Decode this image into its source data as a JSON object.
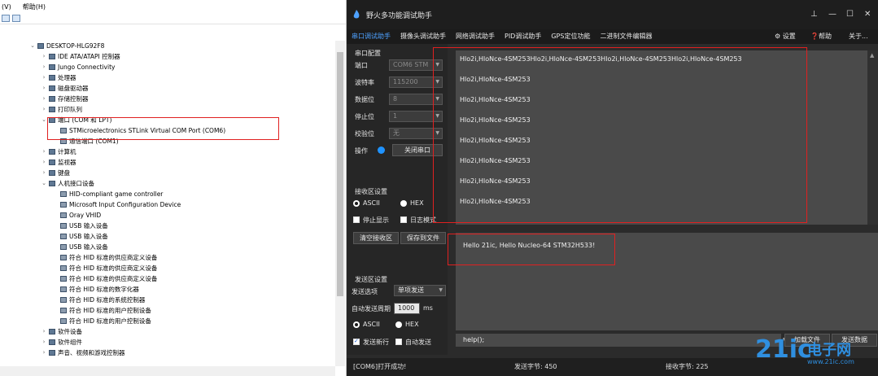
{
  "device_manager": {
    "menu": [
      "(V)",
      "帮助(H)"
    ],
    "tree": [
      {
        "label": "DESKTOP-HLG92F8",
        "arrow": "⌄"
      },
      {
        "label": "IDE ATA/ATAPI 控制器",
        "arrow": "›"
      },
      {
        "label": "Jungo Connectivity",
        "arrow": "›"
      },
      {
        "label": "处理器",
        "arrow": "›"
      },
      {
        "label": "磁盘驱动器",
        "arrow": "›"
      },
      {
        "label": "存储控制器",
        "arrow": "›"
      },
      {
        "label": "打印队列",
        "arrow": "›"
      },
      {
        "label": "端口 (COM 和 LPT)",
        "arrow": "⌄"
      },
      {
        "label": "STMicroelectronics STLink Virtual COM Port (COM6)",
        "arrow": ""
      },
      {
        "label": "通信端口 (COM1)",
        "arrow": ""
      },
      {
        "label": "计算机",
        "arrow": "›"
      },
      {
        "label": "监视器",
        "arrow": "›"
      },
      {
        "label": "键盘",
        "arrow": "›"
      },
      {
        "label": "人机接口设备",
        "arrow": "⌄"
      },
      {
        "label": "HID-compliant game controller",
        "arrow": ""
      },
      {
        "label": "Microsoft Input Configuration Device",
        "arrow": ""
      },
      {
        "label": "Oray VHID",
        "arrow": ""
      },
      {
        "label": "USB 输入设备",
        "arrow": ""
      },
      {
        "label": "USB 输入设备",
        "arrow": ""
      },
      {
        "label": "USB 输入设备",
        "arrow": ""
      },
      {
        "label": "符合 HID 标准的供应商定义设备",
        "arrow": ""
      },
      {
        "label": "符合 HID 标准的供应商定义设备",
        "arrow": ""
      },
      {
        "label": "符合 HID 标准的供应商定义设备",
        "arrow": ""
      },
      {
        "label": "符合 HID 标准的数字化器",
        "arrow": ""
      },
      {
        "label": "符合 HID 标准的系统控制器",
        "arrow": ""
      },
      {
        "label": "符合 HID 标准的用户控制设备",
        "arrow": ""
      },
      {
        "label": "符合 HID 标准的用户控制设备",
        "arrow": ""
      },
      {
        "label": "软件设备",
        "arrow": "›"
      },
      {
        "label": "软件组件",
        "arrow": "›"
      },
      {
        "label": "声音、视频和游戏控制器",
        "arrow": "›"
      }
    ]
  },
  "app": {
    "title": "野火多功能调试助手",
    "window_controls": {
      "pin": "⊥",
      "min": "—",
      "max": "☐",
      "close": "✕"
    },
    "tabs": [
      "串口调试助手",
      "摄像头调试助手",
      "网络调试助手",
      "PID调试助手",
      "GPS定位功能",
      "二进制文件编辑器"
    ],
    "tab_right": {
      "settings": "设置",
      "help": "帮助",
      "about": "关于..."
    },
    "serial_config": {
      "title": "串口配置",
      "port_label": "端口",
      "port_value": "COM6 STM",
      "baud_label": "波特率",
      "baud_value": "115200",
      "databits_label": "数据位",
      "databits_value": "8",
      "stopbits_label": "停止位",
      "stopbits_value": "1",
      "parity_label": "校验位",
      "parity_value": "无",
      "operate_label": "操作",
      "close_port_button": "关闭串口"
    },
    "recv_settings": {
      "title": "接收区设置",
      "ascii": "ASCII",
      "hex": "HEX",
      "stop_display": "停止显示",
      "log_mode": "日志模式",
      "clear_button": "清空接收区",
      "save_button": "保存到文件"
    },
    "send_settings": {
      "title": "发送区设置",
      "send_option_label": "发送选项",
      "send_option_value": "单项发送",
      "auto_period_label": "自动发送周期",
      "auto_period_value": "1000",
      "auto_period_unit": "ms",
      "ascii": "ASCII",
      "hex": "HEX",
      "send_newline": "发送新行",
      "auto_send": "自动发送"
    },
    "receive_lines": [
      "Hlo2i,HloNce-4SM253Hlo2i,HloNce-4SM253Hlo2i,HloNce-4SM253Hlo2i,HloNce-4SM253",
      "Hlo2i,HloNce-4SM253",
      "Hlo2i,HloNce-4SM253",
      "Hlo2i,HloNce-4SM253",
      "Hlo2i,HloNce-4SM253",
      "Hlo2i,HloNce-4SM253",
      "Hlo2i,HloNce-4SM253",
      "Hlo2i,HloNce-4SM253"
    ],
    "send_text": "Hello 21ic, Hello Nucleo-64 STM32H533!",
    "command_input": "help();",
    "load_file_button": "加载文件",
    "send_data_button": "发送数据",
    "status": {
      "message": "[COM6]打开成功!",
      "sent_label": "发送字节: 450",
      "recv_label": "接收字节: 225"
    }
  },
  "watermark": {
    "brand": "21ic",
    "cn": "电子网",
    "url": "www.21ic.com"
  },
  "colors": {
    "accent": "#4ea1ff",
    "highlight": "#e02020",
    "dark_bg": "#2b2b2b"
  }
}
